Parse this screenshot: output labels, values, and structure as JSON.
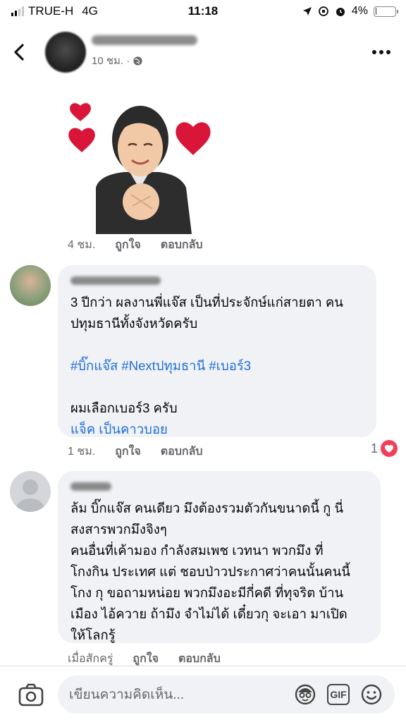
{
  "status_bar": {
    "carrier": "TRUE-H",
    "network": "4G",
    "time": "11:18",
    "battery": "4%",
    "battery_level": 0.04
  },
  "header": {
    "meta": "10 ชม. ·"
  },
  "sticker_actions": {
    "time": "4 ชม.",
    "like": "ถูกใจ",
    "reply": "ตอบกลับ"
  },
  "comments": [
    {
      "lines": [
        "3 ปีกว่า ผลงานพี่แจ๊ส เป็นที่ประจักษ์แก่สายตา คน",
        "ปทุมธานีทั้งจังหวัดครับ"
      ],
      "tags": "#บิ๊กแจ๊ส #Nextปทุมธานี #เบอร์3",
      "line3": "ผมเลือกเบอร์3 ครับ",
      "link": "แจ็ค เป็นคาวบอย",
      "time": "1 ชม.",
      "like": "ถูกใจ",
      "reply": "ตอบกลับ",
      "reactions": "1"
    },
    {
      "lines": [
        "ล้ม บิ๊กแจ๊ส คนเดียว มึงต้องรวมตัวกันขนาดนี้ กู นี่",
        "สงสารพวกมึงจิงๆ",
        "คนอื่นที่เค้ามอง กำลังสมเพช เวทนา พวกมึง ที่",
        "โกงกิน ประเทศ แต่ ชอบป่าวประกาศว่าคนนั้นคนนี้",
        "โกง กุ ขอถามหน่อย พวกมึงอะมีกี่คดี ที่ทุจริต บ้าน",
        "เมือง ไอ้ควาย  ถ้ามึง จำไม่ได้ เดี๋ยวกุ จะเอา มาเปิด",
        "ให้โลกรู้"
      ],
      "time": "เมื่อสักครู่",
      "like": "ถูกใจ",
      "reply": "ตอบกลับ"
    }
  ],
  "composer": {
    "placeholder": "เขียนความคิดเห็น...",
    "gif_label": "GIF"
  },
  "icons": [
    "camera-icon",
    "avatar-sticker-icon",
    "gif-icon",
    "emoji-icon",
    "globe-icon",
    "heart-icon",
    "back-icon",
    "more-icon"
  ],
  "colors": {
    "link": "#216fdb",
    "reaction": "#f33e58",
    "bubble": "#f0f2f5"
  }
}
